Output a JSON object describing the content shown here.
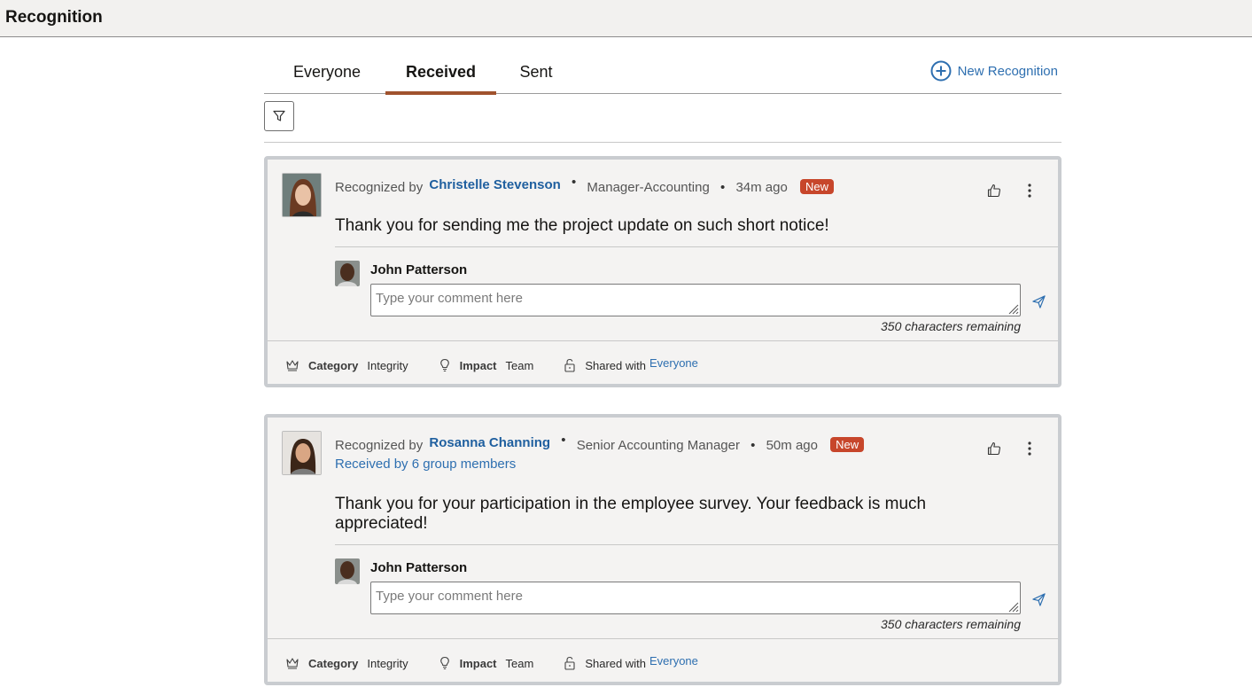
{
  "header": {
    "title": "Recognition"
  },
  "tabs": [
    {
      "label": "Everyone",
      "active": false
    },
    {
      "label": "Received",
      "active": true
    },
    {
      "label": "Sent",
      "active": false
    }
  ],
  "new_recognition": {
    "label": "New Recognition",
    "icon": "plus-circle-icon"
  },
  "filter": {
    "icon": "filter-icon"
  },
  "colors": {
    "accent": "#a0522d",
    "link": "#2e6fb0",
    "badge": "#c7462b",
    "card_bg": "#f4f3f2",
    "card_border": "#c9ccd0"
  },
  "recognitions": [
    {
      "recognized_by_label": "Recognized by",
      "recognizer": "Christelle Stevenson",
      "title": "Manager-Accounting",
      "time": "34m ago",
      "badge": "New",
      "group_text": "",
      "message": "Thank you for sending me the project update on such short notice!",
      "commenter": "John Patterson",
      "comment_placeholder": "Type your comment here",
      "remaining": "350 characters remaining",
      "category_label": "Category",
      "category": "Integrity",
      "impact_label": "Impact",
      "impact": "Team",
      "shared_label": "Shared with",
      "shared": "Everyone"
    },
    {
      "recognized_by_label": "Recognized by",
      "recognizer": "Rosanna Channing",
      "title": "Senior Accounting Manager",
      "time": "50m ago",
      "badge": "New",
      "group_text": "Received by 6 group members",
      "message": "Thank you for your participation in the employee survey. Your feedback is much appreciated!",
      "commenter": "John Patterson",
      "comment_placeholder": "Type your comment here",
      "remaining": "350 characters remaining",
      "category_label": "Category",
      "category": "Integrity",
      "impact_label": "Impact",
      "impact": "Team",
      "shared_label": "Shared with",
      "shared": "Everyone"
    }
  ]
}
